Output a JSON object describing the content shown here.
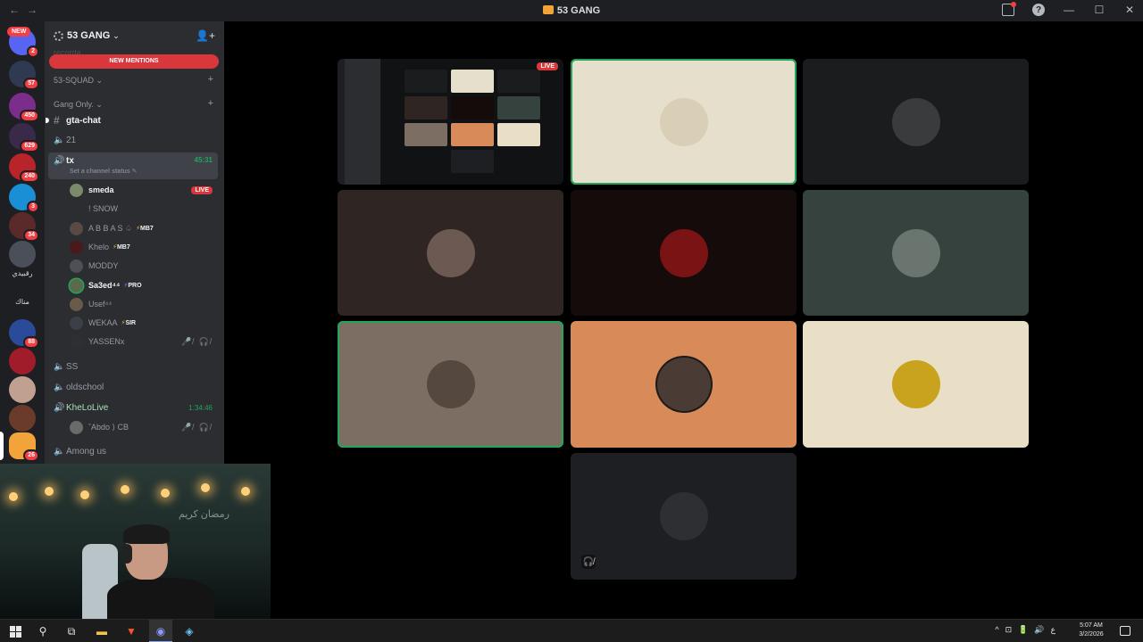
{
  "window": {
    "title": "53 GANG",
    "nav_back": "←",
    "nav_forward": "→",
    "help": "?",
    "minimize": "—",
    "maximize": "☐",
    "close": "✕"
  },
  "server_rail": {
    "new_label": "NEW",
    "badges": [
      "2",
      "57",
      "450",
      "629",
      "240",
      "3",
      "34",
      "88",
      "26"
    ],
    "text_icons": [
      "رقبيدي",
      "مناك"
    ]
  },
  "sidebar": {
    "server_name": "53 GANG",
    "new_mentions": "NEW MENTIONS",
    "faded_channel": "recorda",
    "categories": [
      {
        "label": "53-SQUAD ⌄",
        "plus": "+"
      },
      {
        "label": "Gang Only. ⌄",
        "plus": "+"
      }
    ],
    "channels": {
      "gta_chat": "gta-chat",
      "ch21": "21",
      "tx": "tx",
      "tx_status": "Set a channel status ✎",
      "tx_timer": "45:31",
      "ss": "SS",
      "oldschool": "oldschool",
      "khelolive": "KheLoLive",
      "khelolive_timer": "1:34:46",
      "among_us": "Among us"
    },
    "voice_users": [
      {
        "name": "smeda",
        "badge": "LIVE"
      },
      {
        "name": "! SNOW"
      },
      {
        "name": "A B B A S ♤",
        "tag": "MB7"
      },
      {
        "name": "Khelo",
        "tag": "MB7"
      },
      {
        "name": "MODDY"
      },
      {
        "name": "Sa3ed⁴⁴",
        "tag": "PRO"
      },
      {
        "name": "Usef⁴⁴"
      },
      {
        "name": "WEKAA",
        "tag": "SIR"
      },
      {
        "name": "YASSENx",
        "muted": "🎤̸ 🎧̸"
      }
    ],
    "khelolive_users": [
      {
        "name": "ˇAbdo ⟩ CB",
        "muted": "🎤̸ 🎧̸"
      }
    ]
  },
  "stage": {
    "live_label": "LIVE",
    "tiles": [
      {
        "bg": "#111214",
        "kind": "screen"
      },
      {
        "bg": "#e6dfcb",
        "speaking": true,
        "avatar": "#d9cfb6"
      },
      {
        "bg": "#1b1c1e",
        "avatar": "#3a3b3d"
      },
      {
        "bg": "#2f2624",
        "avatar": "#6c5a52"
      },
      {
        "bg": "#150b0b",
        "avatar": "#7a1414"
      },
      {
        "bg": "#36423d",
        "avatar": "#6b7570"
      },
      {
        "bg": "#7c6e62",
        "speaking": true,
        "avatar": "#55483f"
      },
      {
        "bg": "#d88a58",
        "avatar": "#4a3c34"
      },
      {
        "bg": "#e8dfc6",
        "avatar": "#c9a21e"
      },
      {
        "bg": "#1e1f22",
        "avatar": "#2e2f33",
        "deafened": true
      }
    ],
    "deafened_icon": "🎧̸"
  },
  "webcam": {
    "wall_text": "رمضان كريم"
  },
  "taskbar": {
    "clock_time": "5:07 AM",
    "clock_date": "3/2/2026",
    "tray_icons": [
      "^",
      "⊡",
      "🔋",
      "🔊",
      "ع"
    ]
  }
}
